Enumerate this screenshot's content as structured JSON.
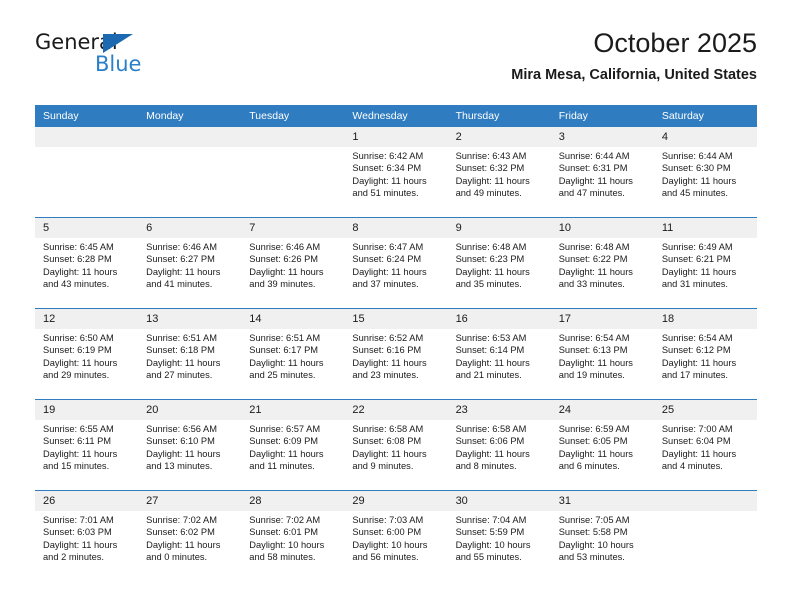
{
  "brand": {
    "name_top": "General",
    "name_bottom": "Blue",
    "triangle_color": "#1b69b0",
    "blue_color": "#2a7fc9"
  },
  "header": {
    "title": "October 2025",
    "subtitle": "Mira Mesa, California, United States"
  },
  "theme": {
    "header_bg": "#2f7cc0",
    "daynum_bg": "#f0f0f0",
    "separator": "#2f7cc0",
    "text": "#1b1b1b"
  },
  "weekday_headers": [
    "Sunday",
    "Monday",
    "Tuesday",
    "Wednesday",
    "Thursday",
    "Friday",
    "Saturday"
  ],
  "weeks": [
    [
      {
        "day": "",
        "sunrise": "",
        "sunset": "",
        "daylight1": "",
        "daylight2": ""
      },
      {
        "day": "",
        "sunrise": "",
        "sunset": "",
        "daylight1": "",
        "daylight2": ""
      },
      {
        "day": "",
        "sunrise": "",
        "sunset": "",
        "daylight1": "",
        "daylight2": ""
      },
      {
        "day": "1",
        "sunrise": "Sunrise: 6:42 AM",
        "sunset": "Sunset: 6:34 PM",
        "daylight1": "Daylight: 11 hours",
        "daylight2": "and 51 minutes."
      },
      {
        "day": "2",
        "sunrise": "Sunrise: 6:43 AM",
        "sunset": "Sunset: 6:32 PM",
        "daylight1": "Daylight: 11 hours",
        "daylight2": "and 49 minutes."
      },
      {
        "day": "3",
        "sunrise": "Sunrise: 6:44 AM",
        "sunset": "Sunset: 6:31 PM",
        "daylight1": "Daylight: 11 hours",
        "daylight2": "and 47 minutes."
      },
      {
        "day": "4",
        "sunrise": "Sunrise: 6:44 AM",
        "sunset": "Sunset: 6:30 PM",
        "daylight1": "Daylight: 11 hours",
        "daylight2": "and 45 minutes."
      }
    ],
    [
      {
        "day": "5",
        "sunrise": "Sunrise: 6:45 AM",
        "sunset": "Sunset: 6:28 PM",
        "daylight1": "Daylight: 11 hours",
        "daylight2": "and 43 minutes."
      },
      {
        "day": "6",
        "sunrise": "Sunrise: 6:46 AM",
        "sunset": "Sunset: 6:27 PM",
        "daylight1": "Daylight: 11 hours",
        "daylight2": "and 41 minutes."
      },
      {
        "day": "7",
        "sunrise": "Sunrise: 6:46 AM",
        "sunset": "Sunset: 6:26 PM",
        "daylight1": "Daylight: 11 hours",
        "daylight2": "and 39 minutes."
      },
      {
        "day": "8",
        "sunrise": "Sunrise: 6:47 AM",
        "sunset": "Sunset: 6:24 PM",
        "daylight1": "Daylight: 11 hours",
        "daylight2": "and 37 minutes."
      },
      {
        "day": "9",
        "sunrise": "Sunrise: 6:48 AM",
        "sunset": "Sunset: 6:23 PM",
        "daylight1": "Daylight: 11 hours",
        "daylight2": "and 35 minutes."
      },
      {
        "day": "10",
        "sunrise": "Sunrise: 6:48 AM",
        "sunset": "Sunset: 6:22 PM",
        "daylight1": "Daylight: 11 hours",
        "daylight2": "and 33 minutes."
      },
      {
        "day": "11",
        "sunrise": "Sunrise: 6:49 AM",
        "sunset": "Sunset: 6:21 PM",
        "daylight1": "Daylight: 11 hours",
        "daylight2": "and 31 minutes."
      }
    ],
    [
      {
        "day": "12",
        "sunrise": "Sunrise: 6:50 AM",
        "sunset": "Sunset: 6:19 PM",
        "daylight1": "Daylight: 11 hours",
        "daylight2": "and 29 minutes."
      },
      {
        "day": "13",
        "sunrise": "Sunrise: 6:51 AM",
        "sunset": "Sunset: 6:18 PM",
        "daylight1": "Daylight: 11 hours",
        "daylight2": "and 27 minutes."
      },
      {
        "day": "14",
        "sunrise": "Sunrise: 6:51 AM",
        "sunset": "Sunset: 6:17 PM",
        "daylight1": "Daylight: 11 hours",
        "daylight2": "and 25 minutes."
      },
      {
        "day": "15",
        "sunrise": "Sunrise: 6:52 AM",
        "sunset": "Sunset: 6:16 PM",
        "daylight1": "Daylight: 11 hours",
        "daylight2": "and 23 minutes."
      },
      {
        "day": "16",
        "sunrise": "Sunrise: 6:53 AM",
        "sunset": "Sunset: 6:14 PM",
        "daylight1": "Daylight: 11 hours",
        "daylight2": "and 21 minutes."
      },
      {
        "day": "17",
        "sunrise": "Sunrise: 6:54 AM",
        "sunset": "Sunset: 6:13 PM",
        "daylight1": "Daylight: 11 hours",
        "daylight2": "and 19 minutes."
      },
      {
        "day": "18",
        "sunrise": "Sunrise: 6:54 AM",
        "sunset": "Sunset: 6:12 PM",
        "daylight1": "Daylight: 11 hours",
        "daylight2": "and 17 minutes."
      }
    ],
    [
      {
        "day": "19",
        "sunrise": "Sunrise: 6:55 AM",
        "sunset": "Sunset: 6:11 PM",
        "daylight1": "Daylight: 11 hours",
        "daylight2": "and 15 minutes."
      },
      {
        "day": "20",
        "sunrise": "Sunrise: 6:56 AM",
        "sunset": "Sunset: 6:10 PM",
        "daylight1": "Daylight: 11 hours",
        "daylight2": "and 13 minutes."
      },
      {
        "day": "21",
        "sunrise": "Sunrise: 6:57 AM",
        "sunset": "Sunset: 6:09 PM",
        "daylight1": "Daylight: 11 hours",
        "daylight2": "and 11 minutes."
      },
      {
        "day": "22",
        "sunrise": "Sunrise: 6:58 AM",
        "sunset": "Sunset: 6:08 PM",
        "daylight1": "Daylight: 11 hours",
        "daylight2": "and 9 minutes."
      },
      {
        "day": "23",
        "sunrise": "Sunrise: 6:58 AM",
        "sunset": "Sunset: 6:06 PM",
        "daylight1": "Daylight: 11 hours",
        "daylight2": "and 8 minutes."
      },
      {
        "day": "24",
        "sunrise": "Sunrise: 6:59 AM",
        "sunset": "Sunset: 6:05 PM",
        "daylight1": "Daylight: 11 hours",
        "daylight2": "and 6 minutes."
      },
      {
        "day": "25",
        "sunrise": "Sunrise: 7:00 AM",
        "sunset": "Sunset: 6:04 PM",
        "daylight1": "Daylight: 11 hours",
        "daylight2": "and 4 minutes."
      }
    ],
    [
      {
        "day": "26",
        "sunrise": "Sunrise: 7:01 AM",
        "sunset": "Sunset: 6:03 PM",
        "daylight1": "Daylight: 11 hours",
        "daylight2": "and 2 minutes."
      },
      {
        "day": "27",
        "sunrise": "Sunrise: 7:02 AM",
        "sunset": "Sunset: 6:02 PM",
        "daylight1": "Daylight: 11 hours",
        "daylight2": "and 0 minutes."
      },
      {
        "day": "28",
        "sunrise": "Sunrise: 7:02 AM",
        "sunset": "Sunset: 6:01 PM",
        "daylight1": "Daylight: 10 hours",
        "daylight2": "and 58 minutes."
      },
      {
        "day": "29",
        "sunrise": "Sunrise: 7:03 AM",
        "sunset": "Sunset: 6:00 PM",
        "daylight1": "Daylight: 10 hours",
        "daylight2": "and 56 minutes."
      },
      {
        "day": "30",
        "sunrise": "Sunrise: 7:04 AM",
        "sunset": "Sunset: 5:59 PM",
        "daylight1": "Daylight: 10 hours",
        "daylight2": "and 55 minutes."
      },
      {
        "day": "31",
        "sunrise": "Sunrise: 7:05 AM",
        "sunset": "Sunset: 5:58 PM",
        "daylight1": "Daylight: 10 hours",
        "daylight2": "and 53 minutes."
      },
      {
        "day": "",
        "sunrise": "",
        "sunset": "",
        "daylight1": "",
        "daylight2": ""
      }
    ]
  ]
}
